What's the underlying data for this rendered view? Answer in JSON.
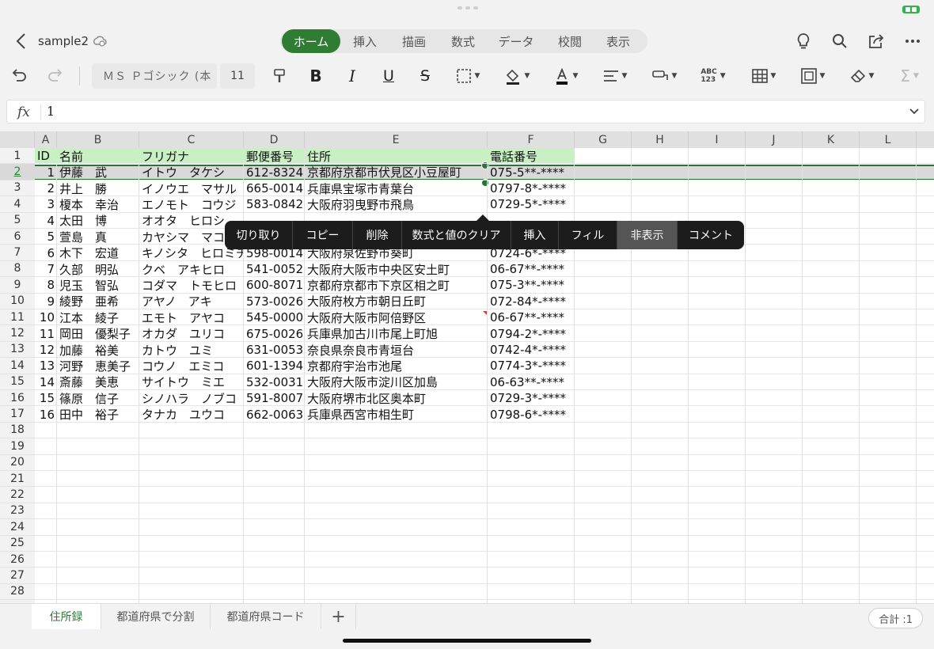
{
  "app": {
    "doc_title": "sample2",
    "tabs": [
      "ホーム",
      "挿入",
      "描画",
      "数式",
      "データ",
      "校閲",
      "表示"
    ],
    "active_tab": 0,
    "accent": "#2e7d32"
  },
  "ribbon": {
    "font_name": "ＭＳ Ｐゴシック (本",
    "font_size": "11",
    "bold_label": "B",
    "italic_label": "I",
    "underline_label": "U",
    "strike_label": "S",
    "number_label_top": "ABC",
    "number_label_bottom": "123",
    "sum_label": "Σ"
  },
  "formula_bar": {
    "fx_label": "fx",
    "value": "1"
  },
  "sheet": {
    "columns": [
      "A",
      "B",
      "C",
      "D",
      "E",
      "F",
      "G",
      "H",
      "I",
      "J",
      "K",
      "L"
    ],
    "row_numbers": [
      "1",
      "2",
      "3",
      "4",
      "5",
      "6",
      "7",
      "8",
      "9",
      "10",
      "11",
      "12",
      "13",
      "14",
      "15",
      "16",
      "17",
      "18",
      "19",
      "20",
      "21",
      "22",
      "23",
      "24",
      "25",
      "26",
      "27",
      "28"
    ],
    "selected_row": "2",
    "header": [
      "ID",
      "名前",
      "フリガナ",
      "郵便番号",
      "住所",
      "電話番号"
    ],
    "rows": [
      [
        "1",
        "伊藤　武",
        "イトウ　タケシ",
        "612-8324",
        "京都府京都市伏見区小豆屋町",
        "075-5**-****"
      ],
      [
        "2",
        "井上　勝",
        "イノウエ　マサル",
        "665-0014",
        "兵庫県宝塚市青葉台",
        "0797-8*-****"
      ],
      [
        "3",
        "榎本　幸治",
        "エノモト　コウジ",
        "583-0842",
        "大阪府羽曳野市飛鳥",
        "0729-5*-****"
      ],
      [
        "4",
        "太田　博",
        "オオタ　ヒロシ",
        "",
        "",
        ""
      ],
      [
        "5",
        "萱島　真",
        "カヤシマ　マコト",
        "",
        "",
        ""
      ],
      [
        "6",
        "木下　宏道",
        "キノシタ　ヒロミチ",
        "598-0014",
        "大阪府泉佐野市葵町",
        "0724-6*-****"
      ],
      [
        "7",
        "久部　明弘",
        "クベ　アキヒロ",
        "541-0052",
        "大阪府大阪市中央区安土町",
        "06-67**-****"
      ],
      [
        "8",
        "児玉　智弘",
        "コダマ　トモヒロ",
        "600-8071",
        "京都府京都市下京区相之町",
        "075-3**-****"
      ],
      [
        "9",
        "綾野　亜希",
        "アヤノ　アキ",
        "573-0026",
        "大阪府枚方市朝日丘町",
        "072-84*-****"
      ],
      [
        "10",
        "江本　綾子",
        "エモト　アヤコ",
        "545-0000",
        "大阪府大阪市阿倍野区",
        "06-67**-****"
      ],
      [
        "11",
        "岡田　優梨子",
        "オカダ　ユリコ",
        "675-0026",
        "兵庫県加古川市尾上町旭",
        "0794-2*-****"
      ],
      [
        "12",
        "加藤　裕美",
        "カトウ　ユミ",
        "631-0053",
        "奈良県奈良市青垣台",
        "0742-4*-****"
      ],
      [
        "13",
        "河野　恵美子",
        "コウノ　エミコ",
        "601-1394",
        "京都府宇治市池尾",
        "0774-3*-****"
      ],
      [
        "14",
        "斎藤　美恵",
        "サイトウ　ミエ",
        "532-0031",
        "大阪府大阪市淀川区加島",
        "06-63**-****"
      ],
      [
        "15",
        "篠原　信子",
        "シノハラ　ノブコ",
        "591-8007",
        "大阪府堺市北区奥本町",
        "0729-3*-****"
      ],
      [
        "16",
        "田中　裕子",
        "タナカ　ユウコ",
        "662-0063",
        "兵庫県西宮市相生町",
        "0798-6*-****"
      ]
    ]
  },
  "context_menu": {
    "items": [
      "切り取り",
      "コピー",
      "削除",
      "数式と値のクリア",
      "挿入",
      "フィル",
      "非表示",
      "コメント"
    ],
    "highlighted": "非表示"
  },
  "sheet_tabs": {
    "tabs": [
      "住所録",
      "都道府県で分割",
      "都道府県コード"
    ],
    "active": 0,
    "add_label": "+",
    "sum_label": "合計 :1"
  }
}
